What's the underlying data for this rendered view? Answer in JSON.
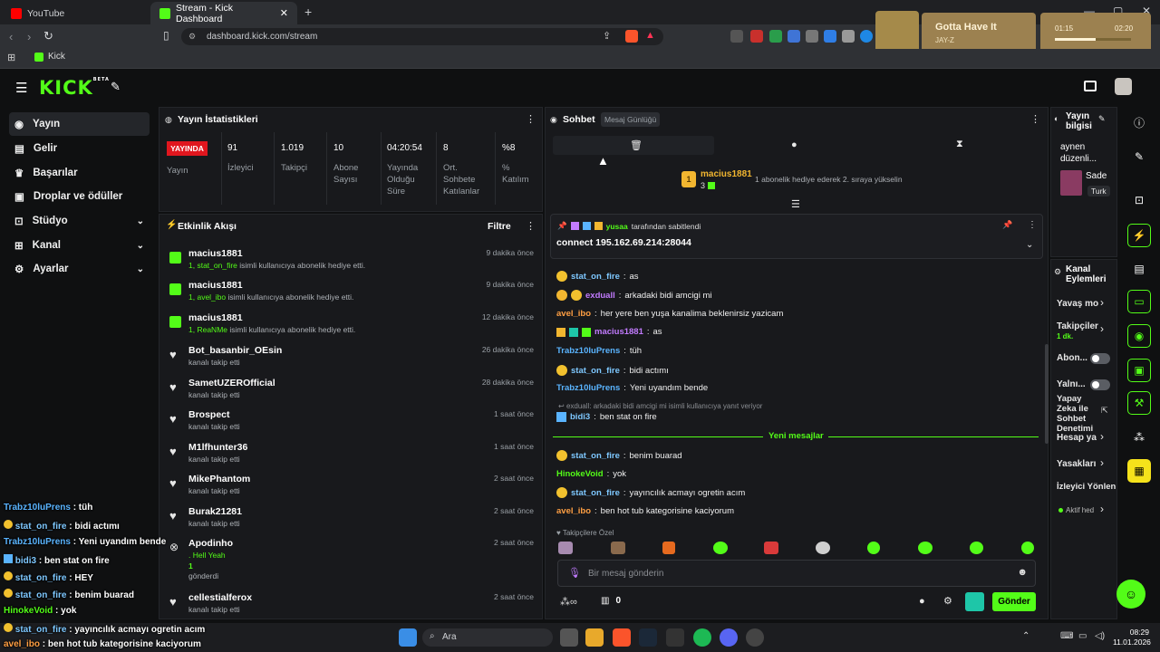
{
  "browser": {
    "tabs": [
      {
        "label": "YouTube"
      },
      {
        "label": "Stream - Kick Dashboard"
      }
    ],
    "url": "dashboard.kick.com/stream",
    "bookmark": "Kick",
    "media": {
      "title": "Gotta Have It",
      "artist": "JAY-Z",
      "time_current": "01:15",
      "time_total": "02:20",
      "progress": 0.53
    }
  },
  "kick": {
    "logo": "KICK",
    "beta": "BETA"
  },
  "nav": [
    {
      "label": "Yayın"
    },
    {
      "label": "Gelir"
    },
    {
      "label": "Başarılar"
    },
    {
      "label": "Droplar ve ödüller"
    },
    {
      "label": "Stüdyo"
    },
    {
      "label": "Kanal"
    },
    {
      "label": "Ayarlar"
    }
  ],
  "stats": {
    "title": "Yayın İstatistikleri",
    "live_badge": "YAYINDA",
    "live_label": "Yayın",
    "items": [
      {
        "value": "91",
        "label": "İzleyici"
      },
      {
        "value": "1.019",
        "label": "Takipçi"
      },
      {
        "value": "10",
        "label": "Abone Sayısı"
      },
      {
        "value": "04:20:54",
        "label": "Yayında Olduğu Süre"
      },
      {
        "value": "8",
        "label": "Ort. Sohbete Katılanlar"
      },
      {
        "value": "%8",
        "label": "% Katılım"
      }
    ]
  },
  "activity": {
    "title": "Etkinlik Akışı",
    "filter": "Filtre",
    "events": [
      {
        "name": "macius1881",
        "sub_count": "1,",
        "sub_user": "stat_on_fire",
        "sub_text": " isimli kullanıcıya abonelik hediye etti.",
        "time": "9 dakika önce"
      },
      {
        "name": "macius1881",
        "sub_count": "1,",
        "sub_user": "avel_ibo",
        "sub_text": " isimli kullanıcıya abonelik hediye etti.",
        "time": "9 dakika önce"
      },
      {
        "name": "macius1881",
        "sub_count": "1,",
        "sub_user": "ReaNMe",
        "sub_text": " isimli kullanıcıya abonelik hediye etti.",
        "time": "12 dakika önce"
      },
      {
        "name": "Bot_basanbir_OEsin",
        "sub_text": "kanalı takip etti",
        "time": "26 dakika önce"
      },
      {
        "name": "SametUZEROfficial",
        "sub_text": "kanalı takip etti",
        "time": "28 dakika önce"
      },
      {
        "name": "Brospect",
        "sub_text": "kanalı takip etti",
        "time": "1 saat önce"
      },
      {
        "name": "M1lfhunter36",
        "sub_text": "kanalı takip etti",
        "time": "1 saat önce"
      },
      {
        "name": "MikePhantom",
        "sub_text": "kanalı takip etti",
        "time": "2 saat önce"
      },
      {
        "name": "Burak21281",
        "sub_text": "kanalı takip etti",
        "time": "2 saat önce"
      },
      {
        "name": "cellestialferox",
        "sub_text": "kanalı takip etti",
        "time": "2 saat önce"
      }
    ],
    "apodinho": {
      "name": "Apodinho",
      "msg": ". Hell Yeah",
      "count": "1",
      "sent": "gönderdi",
      "time": "2 saat önce"
    }
  },
  "chat": {
    "title": "Sohbet",
    "tooltip": "Mesaj Günlüğü",
    "top_gifter": {
      "name": "macius1881",
      "rank": "1",
      "count": "3",
      "note": "1 abonelik hediye ederek 2. sıraya yükselin"
    },
    "pinned": {
      "by_user": "yusaa",
      "by_text": "tarafından sabitlendi",
      "message": "connect 195.162.69.214:28044"
    },
    "messages": [
      {
        "user": "stat_on_fire",
        "color": "#7ec8ff",
        "text": "as",
        "emo": true
      },
      {
        "user": "exduall",
        "color": "#c27bff",
        "text": "arkadaki bidi amcigi mi",
        "emo": true
      },
      {
        "user": "avel_ibo",
        "color": "#ff9f43",
        "text": "her yere ben yuşa kanalima beklenirsiz yazicam"
      },
      {
        "user": "macius1881",
        "color": "#c27bff",
        "text": "as"
      },
      {
        "user": "Trabz10luPrens",
        "color": "#5ab4ff",
        "text": "tüh"
      },
      {
        "user": "stat_on_fire",
        "color": "#7ec8ff",
        "text": "bidi actımı",
        "emo": true
      },
      {
        "user": "Trabz10luPrens",
        "color": "#5ab4ff",
        "text": "Yeni uyandım bende"
      }
    ],
    "reply_ref": "exduall: arkadaki bidi amcigi mi isimli kullanıcıya yanıt veriyor",
    "reply": {
      "user": "bidi3",
      "color": "#7ec8ff",
      "text": "ben stat on fire"
    },
    "new_label": "Yeni mesajlar",
    "new_messages": [
      {
        "user": "stat_on_fire",
        "color": "#7ec8ff",
        "text": "benim buarad",
        "emo": true
      },
      {
        "user": "HinokeVoid",
        "color": "#53fc18",
        "text": "yok"
      },
      {
        "user": "stat_on_fire",
        "color": "#7ec8ff",
        "text": "yayıncılık acmayı ogretin acım",
        "emo": true
      },
      {
        "user": "avel_ibo",
        "color": "#ff9f43",
        "text": "ben hot tub kategorisine kaciyorum"
      }
    ],
    "followers_only": "Takipçilere Özel",
    "input_placeholder": "Bir mesaj gönderin",
    "points": "0",
    "send": "Gönder"
  },
  "stream_info": {
    "title": "Yayın bilgisi",
    "desc": "aynen düzenli...",
    "cat": "Sade",
    "tag": "Turk"
  },
  "channel_actions": {
    "title": "Kanal Eylemleri",
    "items": [
      {
        "label": "Yavaş mo"
      },
      {
        "label": "Takipçiler",
        "sub": "1 dk."
      },
      {
        "label": "Abon..."
      },
      {
        "label": "Yalnı..."
      },
      {
        "label": "Yapay Zeka ile Sohbet Denetimi"
      },
      {
        "label": "Hesap ya"
      },
      {
        "label": "Yasakları"
      },
      {
        "label": "İzleyici Yönlen"
      },
      {
        "label": "Aktif hed"
      }
    ]
  },
  "overlay_chat": [
    {
      "user": "Trabz10luPrens",
      "text": " : tüh",
      "color": "#5ab4ff"
    },
    {
      "user": "stat_on_fire",
      "text": " : bidi actımı",
      "color": "#7ec8ff"
    },
    {
      "user": "Trabz10luPrens",
      "text": " : Yeni uyandım bende",
      "color": "#5ab4ff"
    },
    {
      "user": "bidi3",
      "text": " : ben stat on fire",
      "color": "#7ec8ff"
    },
    {
      "user": "stat_on_fire",
      "text": " : HEY",
      "color": "#7ec8ff"
    },
    {
      "user": "stat_on_fire",
      "text": " : benim buarad",
      "color": "#7ec8ff"
    },
    {
      "user": "HinokeVoid",
      "text": " : yok",
      "color": "#53fc18"
    },
    {
      "user": "stat_on_fire",
      "text": " : yayıncılık acmayı ogretin acım",
      "color": "#7ec8ff"
    },
    {
      "user": "avel_ibo",
      "text": " : ben hot tub kategorisine kaciyorum",
      "color": "#ff9f43"
    }
  ],
  "taskbar": {
    "search": "Ara",
    "time": "08:29",
    "date": "11.01.2026"
  }
}
